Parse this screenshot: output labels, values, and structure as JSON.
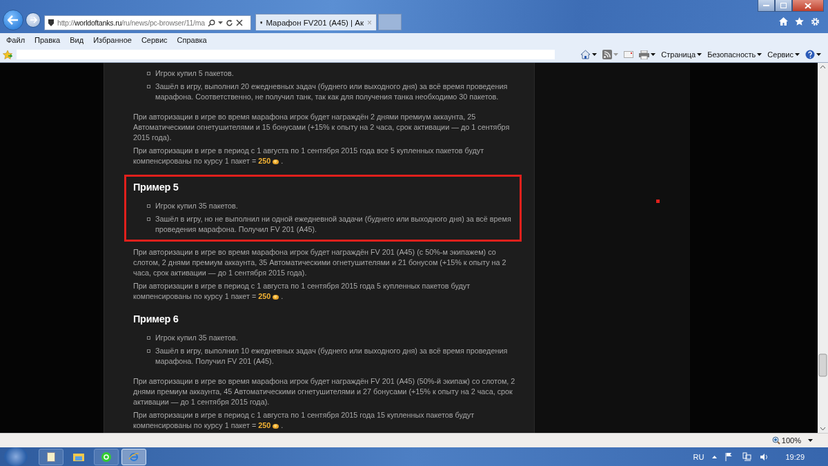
{
  "browser": {
    "address": "http://**worldoftanks.ru**/ru/news/pc-browser/11/ma",
    "tabs": [
      {
        "title": "Марафон FV201 (A45) | Ак",
        "close_mark": "×",
        "selected": true
      }
    ]
  },
  "menu": [
    "Файл",
    "Правка",
    "Вид",
    "Избранное",
    "Сервис",
    "Справка"
  ],
  "command_bar": [
    "Страница",
    "Безопасность",
    "Сервис"
  ],
  "article": [
    {
      "kind": "list",
      "items": [
        "Игрок купил 5 пакетов.",
        "Зашёл в игру, выполнил 20 ежедневных задач (буднего или выходного дня) за всё время проведения марафона. Соответственно, не получил танк, так как для получения танка необходимо 30 пакетов."
      ]
    },
    {
      "kind": "paragraph",
      "text": "При авторизации в игре во время марафона игрок будет награждён 2 днями премиум аккаунта, 25 Автоматическими огнетушителями и 15 бонусами (+15% к опыту на 2 часа, срок активации — до 1 сентября 2015 года)."
    },
    {
      "kind": "compensation",
      "text": "При авторизации в игре в период с 1 августа по 1 сентября 2015 года все 5 купленных пакетов будут компенсированы по курсу 1 пакет = **250**",
      "end": "."
    },
    {
      "kind": "example",
      "title": "Пример 5",
      "highlighted": true,
      "items": [
        "Игрок купил 35 пакетов.",
        "Зашёл в игру, но не выполнил ни одной ежедневной задачи (буднего или выходного дня) за всё время проведения марафона. Получил FV 201 (A45)."
      ]
    },
    {
      "kind": "paragraph",
      "text": "При авторизации в игре во время марафона игрок будет награждён FV 201 (A45) (с 50%-м экипажем) со слотом, 2 днями премиум аккаунта, 35 Автоматическими огнетушителями и 21 бонусом (+15% к опыту на 2 часа, срок активации — до 1 сентября 2015 года)."
    },
    {
      "kind": "compensation",
      "text": "При авторизации в игре в период с 1 августа по 1 сентября 2015 года 5 купленных пакетов будут компенсированы по курсу 1 пакет = **250**",
      "end": "."
    },
    {
      "kind": "example",
      "title": "Пример 6",
      "highlighted": false,
      "items": [
        "Игрок купил 35 пакетов.",
        "Зашёл в игру, выполнил 10 ежедневных задач (буднего или выходного дня) за всё время проведения марафона. Получил FV 201 (A45)."
      ]
    },
    {
      "kind": "paragraph",
      "text": "При авторизации в игре во время марафона игрок будет награждён FV 201 (A45) (50%-й экипаж) со слотом, 2 днями премиум аккаунта, 45 Автоматическими огнетушителями и 27 бонусами (+15% к опыту на 2 часа, срок активации — до 1 сентября 2015 года)."
    },
    {
      "kind": "compensation",
      "text": "При авторизации в игре в период с 1 августа по 1 сентября 2015 года 15 купленных пакетов будут компенсированы по курсу 1 пакет = **250**",
      "end": "."
    }
  ],
  "status_bar": {
    "zoom": "100%"
  },
  "taskbar": {
    "language": "RU",
    "clock": "19:29"
  }
}
